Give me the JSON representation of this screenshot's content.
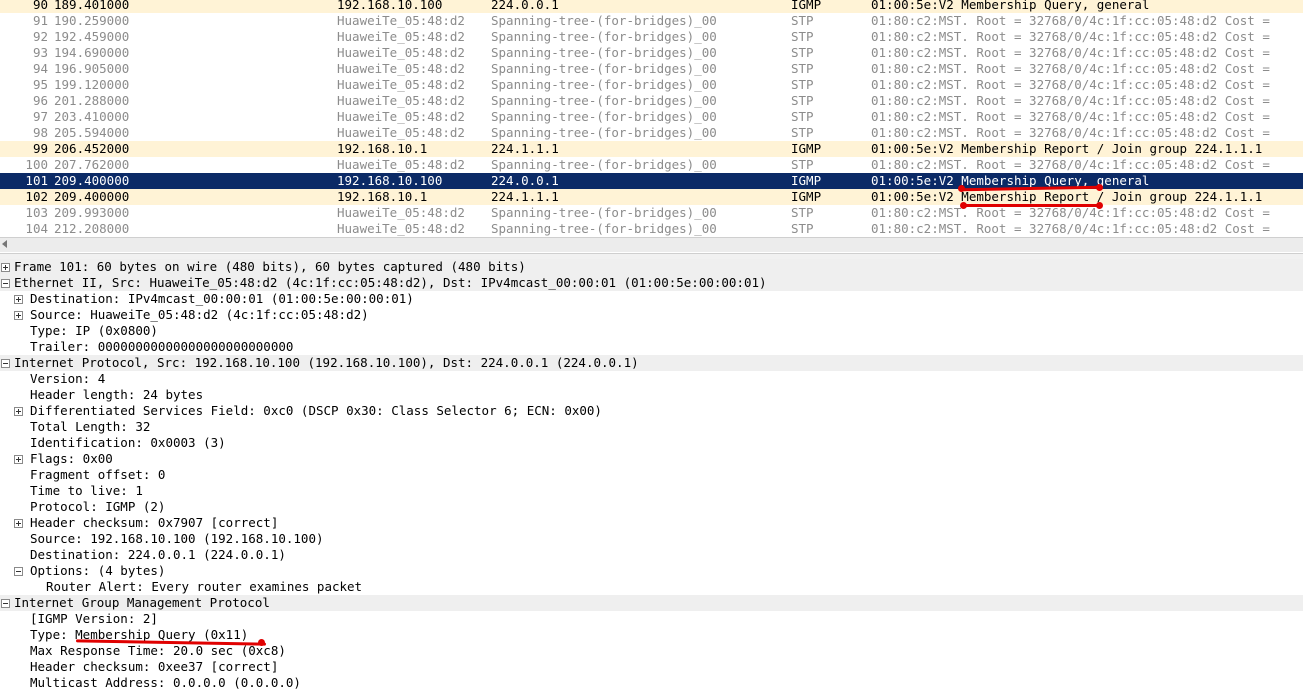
{
  "packets": [
    {
      "no": "90",
      "time": "189.401000",
      "src": "192.168.10.100",
      "dst": "224.0.0.1",
      "proto": "IGMP",
      "info": "01:00:5e:V2 Membership Query, general",
      "kind": "igmp"
    },
    {
      "no": "91",
      "time": "190.259000",
      "src": "HuaweiTe_05:48:d2",
      "dst": "Spanning-tree-(for-bridges)_00",
      "proto": "STP",
      "info": "01:80:c2:MST. Root = 32768/0/4c:1f:cc:05:48:d2  Cost =",
      "kind": "stp"
    },
    {
      "no": "92",
      "time": "192.459000",
      "src": "HuaweiTe_05:48:d2",
      "dst": "Spanning-tree-(for-bridges)_00",
      "proto": "STP",
      "info": "01:80:c2:MST. Root = 32768/0/4c:1f:cc:05:48:d2  Cost =",
      "kind": "stp"
    },
    {
      "no": "93",
      "time": "194.690000",
      "src": "HuaweiTe_05:48:d2",
      "dst": "Spanning-tree-(for-bridges)_00",
      "proto": "STP",
      "info": "01:80:c2:MST. Root = 32768/0/4c:1f:cc:05:48:d2  Cost =",
      "kind": "stp"
    },
    {
      "no": "94",
      "time": "196.905000",
      "src": "HuaweiTe_05:48:d2",
      "dst": "Spanning-tree-(for-bridges)_00",
      "proto": "STP",
      "info": "01:80:c2:MST. Root = 32768/0/4c:1f:cc:05:48:d2  Cost =",
      "kind": "stp"
    },
    {
      "no": "95",
      "time": "199.120000",
      "src": "HuaweiTe_05:48:d2",
      "dst": "Spanning-tree-(for-bridges)_00",
      "proto": "STP",
      "info": "01:80:c2:MST. Root = 32768/0/4c:1f:cc:05:48:d2  Cost =",
      "kind": "stp"
    },
    {
      "no": "96",
      "time": "201.288000",
      "src": "HuaweiTe_05:48:d2",
      "dst": "Spanning-tree-(for-bridges)_00",
      "proto": "STP",
      "info": "01:80:c2:MST. Root = 32768/0/4c:1f:cc:05:48:d2  Cost =",
      "kind": "stp"
    },
    {
      "no": "97",
      "time": "203.410000",
      "src": "HuaweiTe_05:48:d2",
      "dst": "Spanning-tree-(for-bridges)_00",
      "proto": "STP",
      "info": "01:80:c2:MST. Root = 32768/0/4c:1f:cc:05:48:d2  Cost =",
      "kind": "stp"
    },
    {
      "no": "98",
      "time": "205.594000",
      "src": "HuaweiTe_05:48:d2",
      "dst": "Spanning-tree-(for-bridges)_00",
      "proto": "STP",
      "info": "01:80:c2:MST. Root = 32768/0/4c:1f:cc:05:48:d2  Cost =",
      "kind": "stp"
    },
    {
      "no": "99",
      "time": "206.452000",
      "src": "192.168.10.1",
      "dst": "224.1.1.1",
      "proto": "IGMP",
      "info": "01:00:5e:V2 Membership Report / Join group 224.1.1.1",
      "kind": "igmp"
    },
    {
      "no": "100",
      "time": "207.762000",
      "src": "HuaweiTe_05:48:d2",
      "dst": "Spanning-tree-(for-bridges)_00",
      "proto": "STP",
      "info": "01:80:c2:MST. Root = 32768/0/4c:1f:cc:05:48:d2  Cost =",
      "kind": "stp"
    },
    {
      "no": "101",
      "time": "209.400000",
      "src": "192.168.10.100",
      "dst": "224.0.0.1",
      "proto": "IGMP",
      "info": "01:00:5e:V2 Membership Query, general",
      "kind": "selected"
    },
    {
      "no": "102",
      "time": "209.400000",
      "src": "192.168.10.1",
      "dst": "224.1.1.1",
      "proto": "IGMP",
      "info": "01:00:5e:V2 Membership Report / Join group 224.1.1.1",
      "kind": "igmp"
    },
    {
      "no": "103",
      "time": "209.993000",
      "src": "HuaweiTe_05:48:d2",
      "dst": "Spanning-tree-(for-bridges)_00",
      "proto": "STP",
      "info": "01:80:c2:MST. Root = 32768/0/4c:1f:cc:05:48:d2  Cost =",
      "kind": "stp"
    },
    {
      "no": "104",
      "time": "212.208000",
      "src": "HuaweiTe_05:48:d2",
      "dst": "Spanning-tree-(for-bridges)_00",
      "proto": "STP",
      "info": "01:80:c2:MST. Root = 32768/0/4c:1f:cc:05:48:d2  Cost =",
      "kind": "stp"
    }
  ],
  "details": [
    {
      "level": 0,
      "toggle": "plus",
      "header": true,
      "text": "Frame 101: 60 bytes on wire (480 bits), 60 bytes captured (480 bits)"
    },
    {
      "level": 0,
      "toggle": "minus",
      "header": true,
      "text": "Ethernet II, Src: HuaweiTe_05:48:d2 (4c:1f:cc:05:48:d2), Dst: IPv4mcast_00:00:01 (01:00:5e:00:00:01)"
    },
    {
      "level": 1,
      "toggle": "plus",
      "text": "Destination: IPv4mcast_00:00:01 (01:00:5e:00:00:01)"
    },
    {
      "level": 1,
      "toggle": "plus",
      "text": "Source: HuaweiTe_05:48:d2 (4c:1f:cc:05:48:d2)"
    },
    {
      "level": 1,
      "text": "Type: IP (0x0800)"
    },
    {
      "level": 1,
      "text": "Trailer: 00000000000000000000000000"
    },
    {
      "level": 0,
      "toggle": "minus",
      "header": true,
      "text": "Internet Protocol, Src: 192.168.10.100 (192.168.10.100), Dst: 224.0.0.1 (224.0.0.1)"
    },
    {
      "level": 1,
      "text": "Version: 4"
    },
    {
      "level": 1,
      "text": "Header length: 24 bytes"
    },
    {
      "level": 1,
      "toggle": "plus",
      "text": "Differentiated Services Field: 0xc0 (DSCP 0x30: Class Selector 6; ECN: 0x00)"
    },
    {
      "level": 1,
      "text": "Total Length: 32"
    },
    {
      "level": 1,
      "text": "Identification: 0x0003 (3)"
    },
    {
      "level": 1,
      "toggle": "plus",
      "text": "Flags: 0x00"
    },
    {
      "level": 1,
      "text": "Fragment offset: 0"
    },
    {
      "level": 1,
      "text": "Time to live: 1"
    },
    {
      "level": 1,
      "text": "Protocol: IGMP (2)"
    },
    {
      "level": 1,
      "toggle": "plus",
      "text": "Header checksum: 0x7907 [correct]"
    },
    {
      "level": 1,
      "text": "Source: 192.168.10.100 (192.168.10.100)"
    },
    {
      "level": 1,
      "text": "Destination: 224.0.0.1 (224.0.0.1)"
    },
    {
      "level": 1,
      "toggle": "minus",
      "text": "Options: (4 bytes)"
    },
    {
      "level": 2,
      "text": "Router Alert: Every router examines packet"
    },
    {
      "level": 0,
      "toggle": "minus",
      "header": true,
      "text": "Internet Group Management Protocol"
    },
    {
      "level": 1,
      "text": "[IGMP Version: 2]"
    },
    {
      "level": 1,
      "text": "Type: Membership Query (0x11)"
    },
    {
      "level": 1,
      "text": "Max Response Time: 20.0 sec (0xc8)"
    },
    {
      "level": 1,
      "text": "Header checksum: 0xee37 [correct]"
    },
    {
      "level": 1,
      "text": "Multicast Address: 0.0.0.0 (0.0.0.0)"
    }
  ],
  "colors": {
    "igmp_row": "#fff3d6",
    "selected_row": "#0b2a66",
    "stp_text": "#8c8c8c",
    "annotation": "#e00000"
  }
}
